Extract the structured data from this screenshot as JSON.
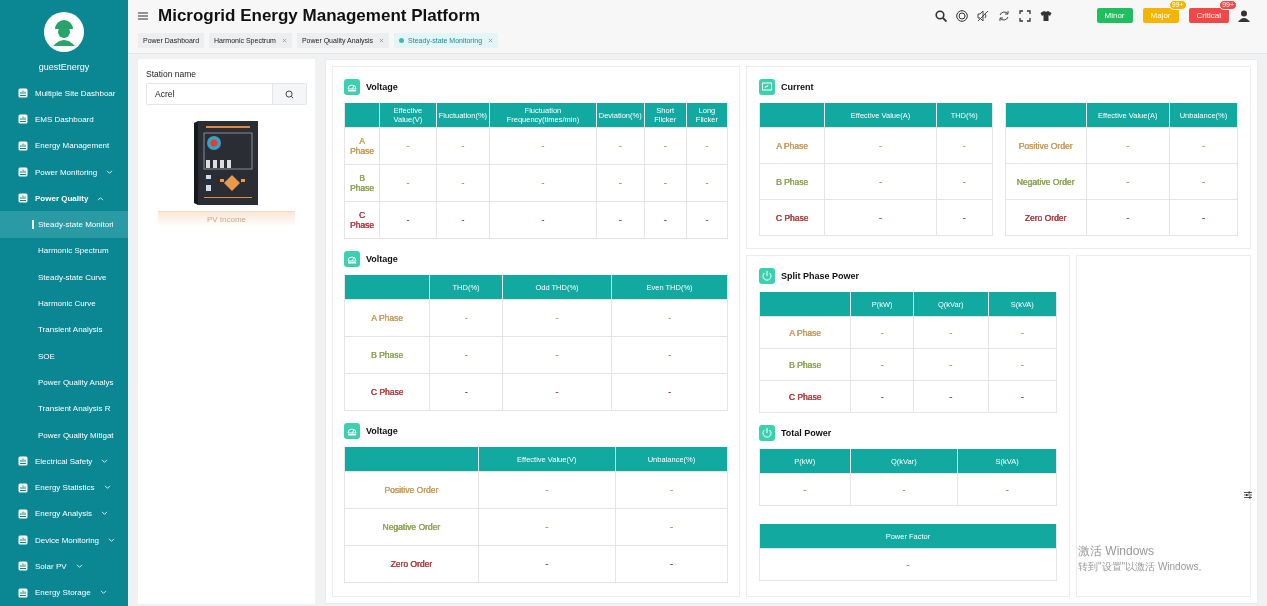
{
  "sidebar": {
    "user": "guestEnergy",
    "items": [
      {
        "label": "Multiple Site Dashboar",
        "kind": "link",
        "selected": false
      },
      {
        "label": "EMS Dashboard",
        "kind": "link",
        "selected": false
      },
      {
        "label": "Energy Management",
        "kind": "link",
        "selected": false
      },
      {
        "label": "Power Monitoring",
        "kind": "group",
        "expanded": false,
        "selected": false
      },
      {
        "label": "Power Quality",
        "kind": "group",
        "expanded": true,
        "selected": false,
        "children": [
          {
            "label": "Steady-state Monitori",
            "selected": true
          },
          {
            "label": "Harmonic Spectrum",
            "selected": false
          },
          {
            "label": "Steady-state Curve",
            "selected": false
          },
          {
            "label": "Harmonic Curve",
            "selected": false
          },
          {
            "label": "Transient Analysis",
            "selected": false
          },
          {
            "label": "SOE",
            "selected": false
          },
          {
            "label": "Power Quality Analys",
            "selected": false
          },
          {
            "label": "Transient Analysis R",
            "selected": false
          },
          {
            "label": "Power Quality Mitigat",
            "selected": false
          }
        ]
      },
      {
        "label": "Electrical Safety",
        "kind": "group",
        "expanded": false,
        "selected": false
      },
      {
        "label": "Energy Statistics",
        "kind": "group",
        "expanded": false,
        "selected": false
      },
      {
        "label": "Energy Analysis",
        "kind": "group",
        "expanded": false,
        "selected": false
      },
      {
        "label": "Device Monitoring",
        "kind": "group",
        "expanded": false,
        "selected": false
      },
      {
        "label": "Solar PV",
        "kind": "group",
        "expanded": false,
        "selected": false
      },
      {
        "label": "Energy Storage",
        "kind": "group",
        "expanded": false,
        "selected": false
      }
    ]
  },
  "header": {
    "title": "Microgrid Energy Management Platform",
    "alarms": [
      {
        "label": "Minor",
        "color": "#1fbf5f"
      },
      {
        "label": "Major",
        "color": "#f5b400",
        "count": "99+"
      },
      {
        "label": "Critical",
        "color": "#f04848",
        "count": "99+"
      }
    ]
  },
  "tabs": [
    {
      "label": "Power Dashboard",
      "closable": false,
      "selected": false
    },
    {
      "label": "Harmonic Spectrum",
      "closable": true,
      "selected": false
    },
    {
      "label": "Power Quality Analysis",
      "closable": true,
      "selected": false
    },
    {
      "label": "Steady-state Monitoring",
      "closable": true,
      "selected": true
    }
  ],
  "station": {
    "label": "Station name",
    "value": "Acrel",
    "caption": "PV Income"
  },
  "left_sections": [
    {
      "title": "Voltage",
      "table": {
        "corner": true,
        "columns": [
          "Effective Value(V)",
          "Fluctuation(%)",
          "Fluctuation Frequency(times/min)",
          "Deviation(%)",
          "Short Flicker",
          "Long Flicker"
        ],
        "rows": [
          {
            "label": "A Phase",
            "color": "#c9a062",
            "cells": [
              "-",
              "-",
              "-",
              "-",
              "-",
              "-"
            ]
          },
          {
            "label": "B Phase",
            "color": "#93a85c",
            "cells": [
              "-",
              "-",
              "-",
              "-",
              "-",
              "-"
            ]
          },
          {
            "label": "C Phase",
            "color": "#b2474a",
            "cells": [
              "-",
              "-",
              "-",
              "-",
              "-",
              "-"
            ]
          }
        ]
      }
    },
    {
      "title": "Voltage",
      "table": {
        "corner": true,
        "columns": [
          "THD(%)",
          "Odd THD(%)",
          "Even THD(%)"
        ],
        "rows": [
          {
            "label": "A Phase",
            "color": "#c9a062",
            "cells": [
              "-",
              "-",
              "-"
            ]
          },
          {
            "label": "B Phase",
            "color": "#93a85c",
            "cells": [
              "-",
              "-",
              "-"
            ]
          },
          {
            "label": "C Phase",
            "color": "#b2474a",
            "cells": [
              "-",
              "-",
              "-"
            ]
          }
        ]
      }
    },
    {
      "title": "Voltage",
      "table": {
        "corner": true,
        "columns": [
          "Effective Value(V)",
          "Unbalance(%)"
        ],
        "rows": [
          {
            "label": "Positive Order",
            "color": "#c9a062",
            "cells": [
              "-",
              "-"
            ]
          },
          {
            "label": "Negative Order",
            "color": "#93a85c",
            "cells": [
              "-",
              "-"
            ]
          },
          {
            "label": "Zero Order",
            "color": "#b2474a",
            "cells": [
              "-",
              "-"
            ]
          }
        ]
      }
    }
  ],
  "current": {
    "title": "Current",
    "tables": [
      {
        "corner": true,
        "columns": [
          "Effective Value(A)",
          "THD(%)"
        ],
        "rows": [
          {
            "label": "A Phase",
            "color": "#c9a062",
            "cells": [
              "-",
              "-"
            ]
          },
          {
            "label": "B Phase",
            "color": "#93a85c",
            "cells": [
              "-",
              "-"
            ]
          },
          {
            "label": "C Phase",
            "color": "#b2474a",
            "cells": [
              "-",
              "-"
            ]
          }
        ]
      },
      {
        "corner": true,
        "columns": [
          "Effective Value(A)",
          "Unbalance(%)"
        ],
        "rows": [
          {
            "label": "Positive Order",
            "color": "#c9a062",
            "cells": [
              "-",
              "-"
            ]
          },
          {
            "label": "Negative Order",
            "color": "#93a85c",
            "cells": [
              "-",
              "-"
            ]
          },
          {
            "label": "Zero Order",
            "color": "#b2474a",
            "cells": [
              "-",
              "-"
            ]
          }
        ]
      }
    ]
  },
  "power_sections": [
    {
      "title": "Split Phase Power",
      "table": {
        "corner": true,
        "columns": [
          "P(kW)",
          "Q(kVar)",
          "S(kVA)"
        ],
        "rows": [
          {
            "label": "A Phase",
            "color": "#c9a062",
            "cells": [
              "-",
              "-",
              "-"
            ]
          },
          {
            "label": "B Phase",
            "color": "#93a85c",
            "cells": [
              "-",
              "-",
              "-"
            ]
          },
          {
            "label": "C Phase",
            "color": "#b2474a",
            "cells": [
              "-",
              "-",
              "-"
            ]
          }
        ]
      }
    },
    {
      "title": "Total Power",
      "table": {
        "corner": false,
        "columns": [
          "P(kW)",
          "Q(kVar)",
          "S(kVA)"
        ],
        "rows": [
          {
            "cells": [
              "-",
              "-",
              "-"
            ]
          }
        ]
      }
    },
    {
      "table": {
        "corner": false,
        "columns": [
          "Power Factor"
        ],
        "rows": [
          {
            "cells": [
              "-"
            ]
          }
        ]
      }
    }
  ],
  "os_notice": {
    "title": "激活 Windows",
    "text": "转到\"设置\"以激活 Windows。"
  }
}
